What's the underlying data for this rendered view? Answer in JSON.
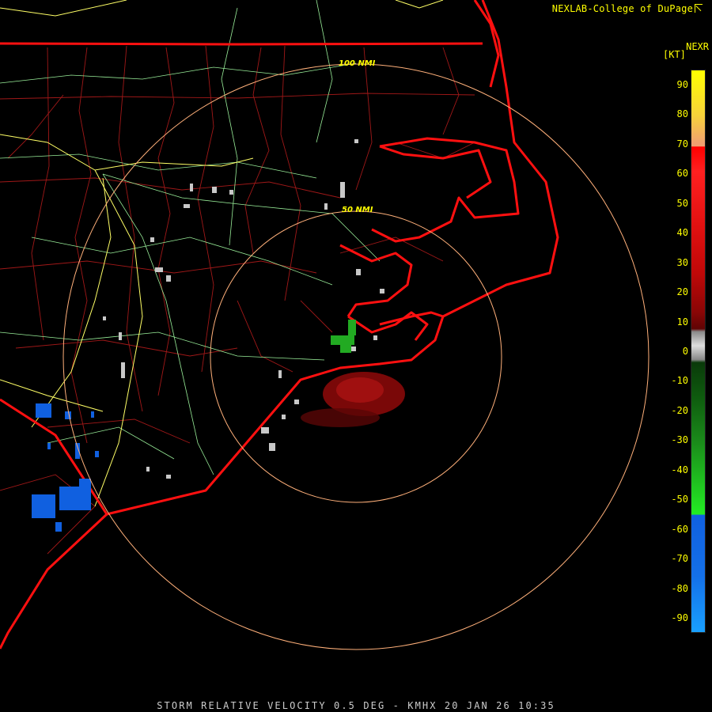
{
  "header": {
    "credit": "NEXLAB-College of DuPage",
    "credit_icon": "external-link-icon"
  },
  "legend": {
    "product": "NEXR",
    "units": "[KT]",
    "ticks": [
      "90",
      "80",
      "70",
      "60",
      "50",
      "40",
      "30",
      "20",
      "10",
      "0",
      "-10",
      "-20",
      "-30",
      "-40",
      "-50",
      "-60",
      "-70",
      "-80",
      "-90"
    ],
    "range": [
      -95,
      95
    ]
  },
  "map": {
    "range_rings": [
      {
        "label": "50 NMI",
        "nmi": 50
      },
      {
        "label": "100 NMI",
        "nmi": 100
      }
    ],
    "colors": {
      "background": "#000000",
      "state_borders": "#ff1010",
      "county_lines": "#a01818",
      "highways": "#ffff66",
      "roads": "#99ee99",
      "range_rings": "#ffb07a",
      "inbound": "#1060e0",
      "outbound": "#8b0a0a",
      "near_zero": "#c8c8c8",
      "weak_inbound": "#22aa22"
    }
  },
  "footer": {
    "caption": "STORM RELATIVE VELOCITY 0.5 DEG - KMHX 20 JAN 26 10:35"
  }
}
